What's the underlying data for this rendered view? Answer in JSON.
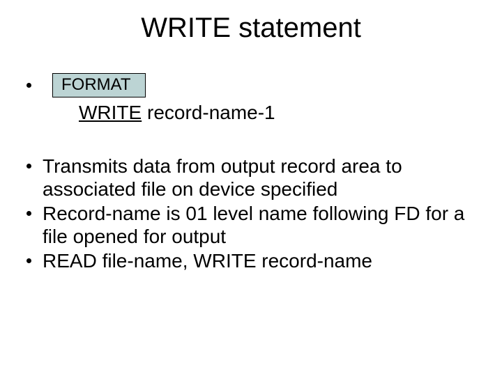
{
  "title": "WRITE statement",
  "format_label": "FORMAT",
  "syntax_keyword": "WRITE",
  "syntax_rest": " record-name-1",
  "bullets": {
    "b1": "Transmits data from output record area to associated file on device specified",
    "b2": "Record-name is 01 level name following FD for a file opened for output",
    "b3": "READ file-name, WRITE record-name"
  }
}
